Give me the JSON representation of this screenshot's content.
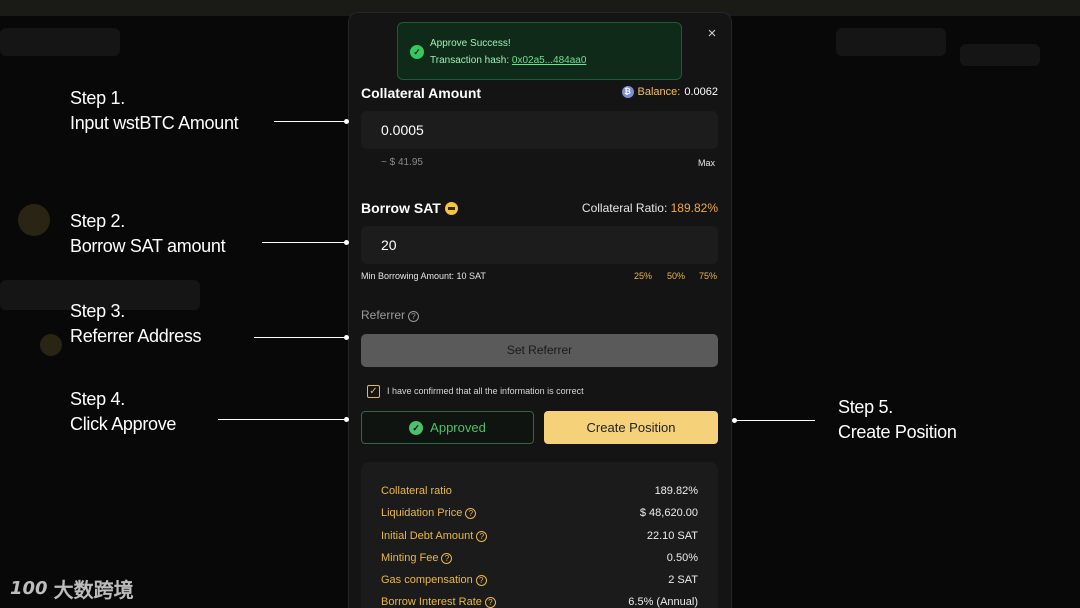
{
  "toast": {
    "title": "Approve Success!",
    "hash_label": "Transaction hash: ",
    "hash_value": "0x02a5...484aa0"
  },
  "close_glyph": "×",
  "collateral": {
    "title": "Collateral Amount",
    "balance_label": "Balance:",
    "balance_value": "0.0062",
    "token_glyph": "₿",
    "input_value": "0.0005",
    "usd_value": "~ $ 41.95",
    "max_label": "Max"
  },
  "borrow": {
    "title": "Borrow SAT",
    "ratio_label": "Collateral Ratio:",
    "ratio_value": "189.82%",
    "input_value": "20",
    "min_label": "Min Borrowing Amount: 10 SAT",
    "pct_buttons": [
      "25%",
      "50%",
      "75%"
    ]
  },
  "referrer": {
    "label": "Referrer",
    "help_glyph": "?",
    "button_label": "Set Referrer"
  },
  "confirm": {
    "checked_glyph": "✓",
    "text": "I have confirmed that all the information is correct"
  },
  "actions": {
    "approved_label": "Approved",
    "check_glyph": "✓",
    "create_label": "Create Position"
  },
  "summary": [
    {
      "key": "Collateral ratio",
      "value": "189.82%",
      "help": false
    },
    {
      "key": "Liquidation Price",
      "value": "$ 48,620.00",
      "help": true
    },
    {
      "key": "Initial Debt Amount",
      "value": "22.10 SAT",
      "help": true
    },
    {
      "key": "Minting Fee",
      "value": "0.50%",
      "help": true
    },
    {
      "key": "Gas compensation",
      "value": "2 SAT",
      "help": true
    },
    {
      "key": "Borrow Interest Rate",
      "value": "6.5% (Annual)",
      "help": true
    }
  ],
  "steps": {
    "s1": {
      "line1": "Step 1.",
      "line2": "Input wstBTC Amount"
    },
    "s2": {
      "line1": "Step 2.",
      "line2": "Borrow SAT amount"
    },
    "s3": {
      "line1": "Step 3.",
      "line2": "Referrer Address"
    },
    "s4": {
      "line1": "Step 4.",
      "line2": "Click Approve"
    },
    "s5": {
      "line1": "Step 5.",
      "line2": "Create Position"
    }
  },
  "watermark": {
    "logo": "100",
    "text": "大数跨境"
  },
  "colors": {
    "accent": "#f5d27a",
    "success": "#4cc06a",
    "highlight": "#e8b84a"
  }
}
